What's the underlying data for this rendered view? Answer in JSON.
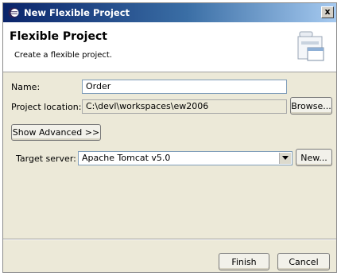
{
  "window": {
    "title": "New Flexible Project",
    "close_label": "x"
  },
  "header": {
    "title": "Flexible Project",
    "description": "Create a flexible project."
  },
  "form": {
    "name_label": "Name:",
    "name_value": "Order",
    "location_label": "Project location:",
    "location_value": "C:\\devl\\workspaces\\ew2006",
    "browse_label": "Browse...",
    "show_advanced_label": "Show Advanced >>",
    "target_server_label": "Target server:",
    "target_server_value": "Apache Tomcat v5.0",
    "new_label": "New..."
  },
  "footer": {
    "finish_label": "Finish",
    "cancel_label": "Cancel"
  },
  "icons": {
    "title_icon": "eclipse-icon",
    "wizard_icon": "project-wizard-icon",
    "dropdown_icon": "chevron-down-icon"
  },
  "colors": {
    "title_gradient_start": "#0a246a",
    "dialog_background": "#ece9d8"
  }
}
